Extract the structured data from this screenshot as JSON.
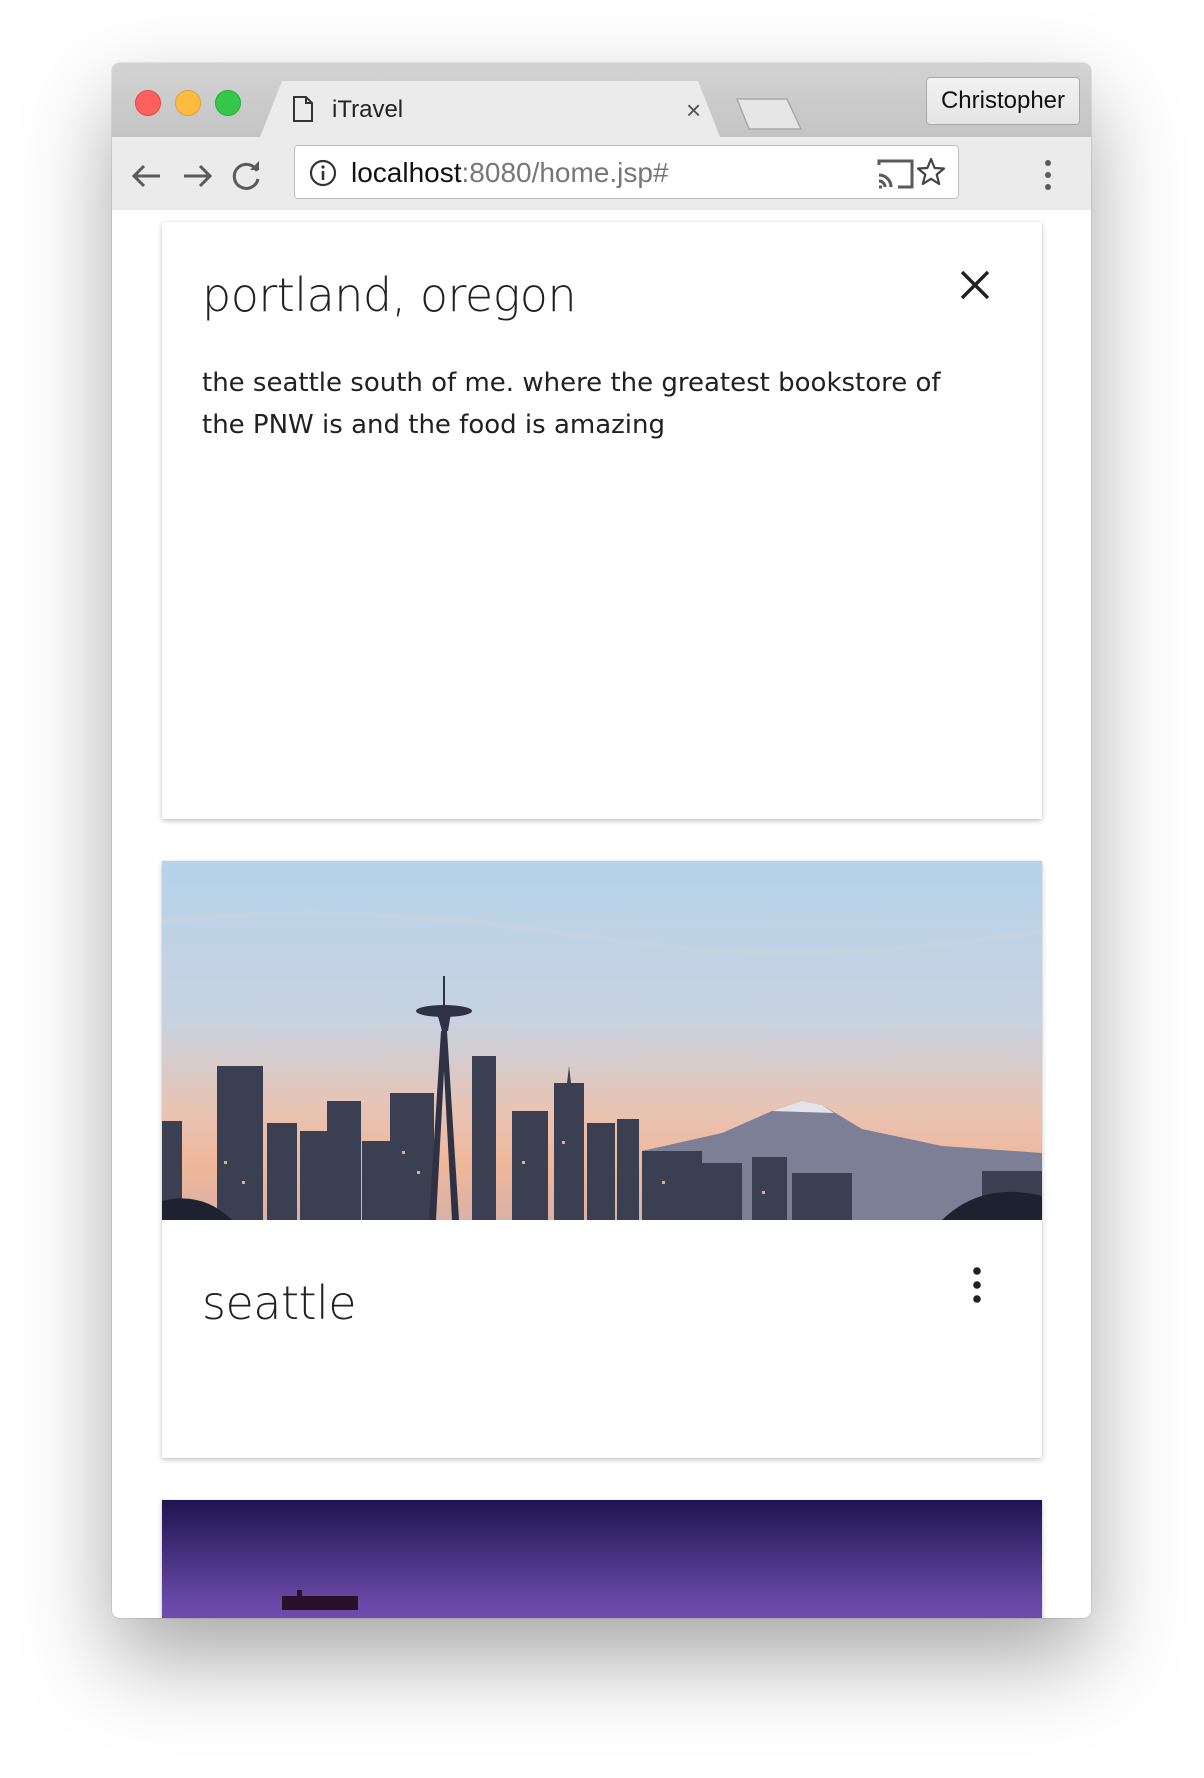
{
  "browser": {
    "tab_title": "iTravel",
    "tab_close": "×",
    "profile_name": "Christopher",
    "url_host": "localhost",
    "url_rest": ":8080/home.jsp#"
  },
  "cards": [
    {
      "title": "portland, oregon",
      "description": "the seattle south of me. where the greatest bookstore of the PNW is and the food is amazing",
      "action_icon": "close-icon"
    },
    {
      "title": "seattle",
      "image": "seattle-skyline-with-space-needle-and-mount-rainier",
      "action_icon": "more-vert-icon"
    },
    {
      "image": "purple-dusk-cityscape"
    }
  ],
  "colors": {
    "close_red": "#fc605c",
    "minimize_yellow": "#fdbc40",
    "zoom_green": "#34c84a",
    "text": "#212121"
  }
}
